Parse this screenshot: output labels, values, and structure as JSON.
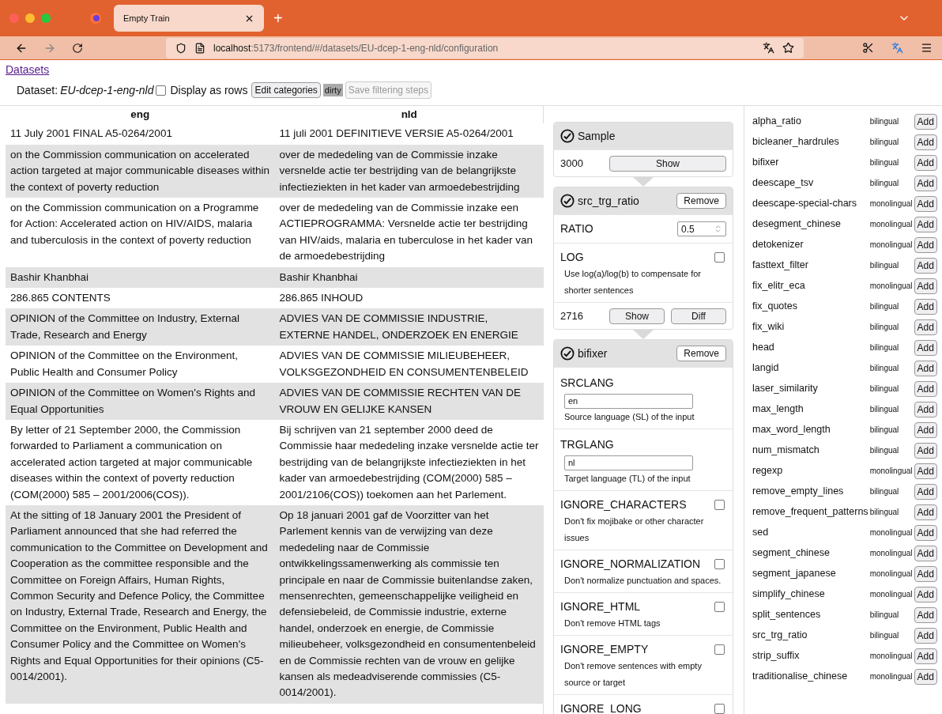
{
  "browser": {
    "tab_title": "Empty Train",
    "new_tab": "+",
    "url_host": "localhost",
    "url_rest": ":5173/frontend/#/datasets/EU-dcep-1-eng-nld/configuration"
  },
  "page": {
    "breadcrumb": "Datasets",
    "dataset_label": "Dataset:",
    "dataset_name": "EU-dcep-1-eng-nld",
    "display_rows": {
      "label": "Display as rows",
      "checked": false
    },
    "edit_button": "Edit categories",
    "status_badge": "dirty",
    "save_button": {
      "label": "Save filtering steps",
      "disabled": true
    }
  },
  "table": {
    "columns": [
      "eng",
      "nld"
    ],
    "rows": [
      {
        "cells": [
          "11 July 2001 FINAL A5-0264/2001",
          "11 juli 2001 DEFINITIEVE VERSIE A5-0264/2001"
        ]
      },
      {
        "cells": [
          "on the Commission communication on accelerated action targeted at major communicable diseases within the context of poverty reduction",
          "over de mededeling van de Commissie inzake versnelde actie ter bestrijding van de belangrijkste infectieziekten in het kader van armoedebestrijding"
        ]
      },
      {
        "cells": [
          "on the Commission communication on a Programme for Action: Accelerated action on HIV/AIDS, malaria and tuberculosis in the context of poverty reduction",
          "over de mededeling van de Commissie inzake een ACTIEPROGRAMMA: Versnelde actie ter bestrijding van HIV/aids, malaria en tuberculose in het kader van de armoedebestrijding"
        ]
      },
      {
        "cells": [
          "Bashir Khanbhai",
          "Bashir Khanbhai"
        ]
      },
      {
        "cells": [
          "286.865 CONTENTS",
          "286.865 INHOUD"
        ]
      },
      {
        "cells": [
          "OPINION of the Committee on Industry, External Trade, Research and Energy",
          "ADVIES VAN DE COMMISSIE INDUSTRIE, EXTERNE HANDEL, ONDERZOEK EN ENERGIE"
        ]
      },
      {
        "cells": [
          "OPINION of the Committee on the Environment, Public Health and Consumer Policy",
          "ADVIES VAN DE COMMISSIE MILIEUBEHEER, VOLKSGEZONDHEID EN CONSUMENTENBELEID"
        ]
      },
      {
        "cells": [
          "OPINION of the Committee on Women's Rights and Equal Opportunities",
          "ADVIES VAN DE COMMISSIE RECHTEN VAN DE VROUW EN GELIJKE KANSEN"
        ]
      },
      {
        "cells": [
          "By letter of 21 September 2000, the Commission forwarded to Parliament a communication on accelerated action targeted at major communicable diseases within the context of poverty reduction (COM(2000) 585 – 2001/2006(COS)).",
          "Bij schrijven van 21 september 2000 deed de Commissie haar mededeling inzake versnelde actie ter bestrijding van de belangrijkste infectieziekten in het kader van armoedebestrijding (COM(2000) 585 – 2001/2106(COS)) toekomen aan het Parlement."
        ]
      },
      {
        "cells": [
          "At the sitting of 18 January 2001 the President of Parliament announced that she had referred the communication to the Committee on Development and Cooperation as the committee responsible and the Committee on Foreign Affairs, Human Rights, Common Security and Defence Policy, the Committee on Industry, External Trade, Research and Energy, the Committee on the Environment, Public Health and Consumer Policy and the Committee on Women's Rights and Equal Opportunities for their opinions (C5-0014/2001).",
          "Op 18 januari 2001 gaf de Voorzitter van het Parlement kennis van de verwijzing van deze mededeling naar de Commissie ontwikkelingssamenwerking als commissie ten principale en naar de Commissie buitenlandse zaken, mensenrechten, gemeenschappelijke veiligheid en defensiebeleid, de Commissie industrie, externe handel, onderzoek en energie, de Commissie milieubeheer, volksgezondheid en consumentenbeleid en de Commissie rechten van de vrouw en gelijke kansen als medeadviserende commissies (C5-0014/2001)."
        ]
      }
    ]
  },
  "pipeline": {
    "steps": [
      {
        "title": "Sample",
        "footer": {
          "count": "3000",
          "buttons": [
            "Show"
          ]
        }
      },
      {
        "title": "src_trg_ratio",
        "remove_button": "Remove",
        "params": [
          {
            "kind": "number",
            "name": "RATIO",
            "value": "0.5"
          },
          {
            "kind": "checkbox",
            "name": "LOG",
            "checked": false,
            "description": "Use log(a)/log(b) to compensate for shorter sentences"
          }
        ],
        "footer": {
          "count": "2716",
          "buttons": [
            "Show",
            "Diff"
          ]
        }
      },
      {
        "title": "bifixer",
        "remove_button": "Remove",
        "params": [
          {
            "kind": "text",
            "name": "SRCLANG",
            "value": "en",
            "description": "Source language (SL) of the input"
          },
          {
            "kind": "text",
            "name": "TRGLANG",
            "value": "nl",
            "description": "Target language (TL) of the input"
          },
          {
            "kind": "checkbox",
            "name": "IGNORE_CHARACTERS",
            "checked": false,
            "description": "Don't fix mojibake or other character issues"
          },
          {
            "kind": "checkbox",
            "name": "IGNORE_NORMALIZATION",
            "checked": false,
            "description": "Don't normalize punctuation and spaces."
          },
          {
            "kind": "checkbox",
            "name": "IGNORE_HTML",
            "checked": false,
            "description": "Don't remove HTML tags"
          },
          {
            "kind": "checkbox",
            "name": "IGNORE_EMPTY",
            "checked": false,
            "description": "Don't remove sentences with empty source or target"
          },
          {
            "kind": "checkbox",
            "name": "IGNORE_LONG",
            "checked": false
          }
        ]
      }
    ]
  },
  "filters": [
    {
      "name": "alpha_ratio",
      "type": "bilingual",
      "button": "Add"
    },
    {
      "name": "bicleaner_hardrules",
      "type": "bilingual",
      "button": "Add"
    },
    {
      "name": "bifixer",
      "type": "bilingual",
      "button": "Add"
    },
    {
      "name": "deescape_tsv",
      "type": "bilingual",
      "button": "Add"
    },
    {
      "name": "deescape-special-chars",
      "type": "monolingual",
      "button": "Add"
    },
    {
      "name": "desegment_chinese",
      "type": "monolingual",
      "button": "Add"
    },
    {
      "name": "detokenizer",
      "type": "monolingual",
      "button": "Add"
    },
    {
      "name": "fasttext_filter",
      "type": "bilingual",
      "button": "Add"
    },
    {
      "name": "fix_elitr_eca",
      "type": "monolingual",
      "button": "Add"
    },
    {
      "name": "fix_quotes",
      "type": "bilingual",
      "button": "Add"
    },
    {
      "name": "fix_wiki",
      "type": "bilingual",
      "button": "Add"
    },
    {
      "name": "head",
      "type": "bilingual",
      "button": "Add"
    },
    {
      "name": "langid",
      "type": "bilingual",
      "button": "Add"
    },
    {
      "name": "laser_similarity",
      "type": "bilingual",
      "button": "Add"
    },
    {
      "name": "max_length",
      "type": "bilingual",
      "button": "Add"
    },
    {
      "name": "max_word_length",
      "type": "bilingual",
      "button": "Add"
    },
    {
      "name": "num_mismatch",
      "type": "bilingual",
      "button": "Add"
    },
    {
      "name": "regexp",
      "type": "monolingual",
      "button": "Add"
    },
    {
      "name": "remove_empty_lines",
      "type": "bilingual",
      "button": "Add"
    },
    {
      "name": "remove_frequent_patterns",
      "type": "bilingual",
      "button": "Add"
    },
    {
      "name": "sed",
      "type": "monolingual",
      "button": "Add"
    },
    {
      "name": "segment_chinese",
      "type": "monolingual",
      "button": "Add"
    },
    {
      "name": "segment_japanese",
      "type": "monolingual",
      "button": "Add"
    },
    {
      "name": "simplify_chinese",
      "type": "monolingual",
      "button": "Add"
    },
    {
      "name": "split_sentences",
      "type": "bilingual",
      "button": "Add"
    },
    {
      "name": "src_trg_ratio",
      "type": "bilingual",
      "button": "Add"
    },
    {
      "name": "strip_suffix",
      "type": "monolingual",
      "button": "Add"
    },
    {
      "name": "traditionalise_chinese",
      "type": "monolingual",
      "button": "Add"
    }
  ]
}
